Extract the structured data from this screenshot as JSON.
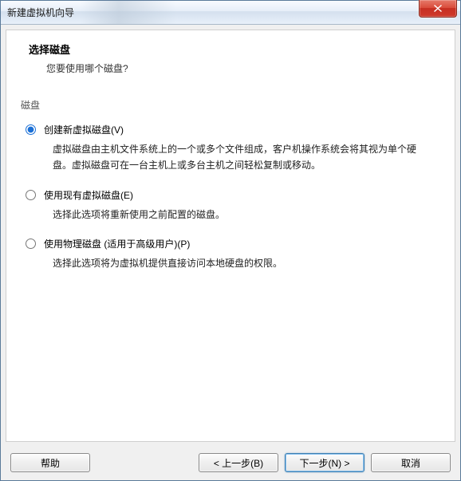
{
  "window": {
    "title": "新建虚拟机向导"
  },
  "header": {
    "title": "选择磁盘",
    "subtitle": "您要使用哪个磁盘?"
  },
  "section": {
    "label": "磁盘"
  },
  "options": [
    {
      "label": "创建新虚拟磁盘(V)",
      "desc": "虚拟磁盘由主机文件系统上的一个或多个文件组成，客户机操作系统会将其视为单个硬盘。虚拟磁盘可在一台主机上或多台主机之间轻松复制或移动。",
      "checked": true
    },
    {
      "label": "使用现有虚拟磁盘(E)",
      "desc": "选择此选项将重新使用之前配置的磁盘。",
      "checked": false
    },
    {
      "label": "使用物理磁盘 (适用于高级用户)(P)",
      "desc": "选择此选项将为虚拟机提供直接访问本地硬盘的权限。",
      "checked": false
    }
  ],
  "buttons": {
    "help": "帮助",
    "back": "< 上一步(B)",
    "next": "下一步(N) >",
    "cancel": "取消"
  }
}
